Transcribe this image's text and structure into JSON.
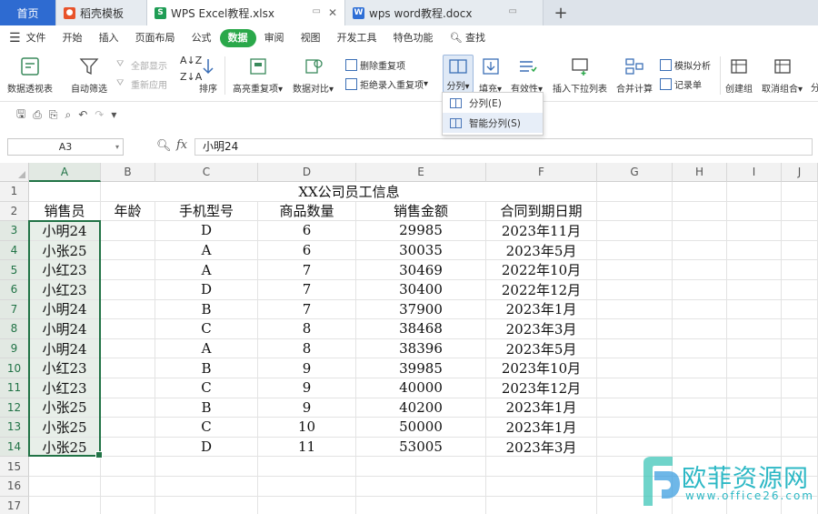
{
  "tabs": {
    "home": "首页",
    "items": [
      {
        "label": "稻壳模板"
      },
      {
        "label": "WPS Excel教程.xlsx"
      },
      {
        "label": "wps word教程.docx"
      }
    ],
    "new_tab": "+"
  },
  "menu": {
    "file": "文件",
    "items": [
      "开始",
      "插入",
      "页面布局",
      "公式",
      "数据",
      "审阅",
      "视图",
      "开发工具",
      "特色功能"
    ],
    "active": "数据",
    "search": "查找"
  },
  "ribbon": {
    "pivot": "数据透视表",
    "autofilter": "自动筛选",
    "show_all": "全部显示",
    "reapply": "重新应用",
    "sort": "排序",
    "highlight_dup": "高亮重复项",
    "compare": "数据对比",
    "remove_dup": "删除重复项",
    "reject_dup": "拒绝录入重复项",
    "split": "分列",
    "fill": "填充",
    "validity": "有效性",
    "insert_dropdown": "插入下拉列表",
    "consolidate": "合并计算",
    "simulate": "模拟分析",
    "record": "记录单",
    "create_group": "创建组",
    "ungroup": "取消组合",
    "more": "分"
  },
  "dropdown": {
    "items": [
      "分列(E)",
      "智能分列(S)"
    ]
  },
  "formula_bar": {
    "cell_ref": "A3",
    "fx": "fx",
    "content": "小明24"
  },
  "sheet": {
    "columns": [
      "A",
      "B",
      "C",
      "D",
      "E",
      "F",
      "G",
      "H",
      "I",
      "J"
    ],
    "rows": [
      "1",
      "2",
      "3",
      "4",
      "5",
      "6",
      "7",
      "8",
      "9",
      "10",
      "11",
      "12",
      "13",
      "14",
      "15",
      "16",
      "17"
    ],
    "title": "XX公司员工信息",
    "headers": [
      "销售员",
      "年龄",
      "手机型号",
      "商品数量",
      "销售金额",
      "合同到期日期"
    ],
    "data": [
      [
        "小明24",
        "",
        "D",
        "6",
        "29985",
        "2023年11月"
      ],
      [
        "小张25",
        "",
        "A",
        "6",
        "30035",
        "2023年5月"
      ],
      [
        "小红23",
        "",
        "A",
        "7",
        "30469",
        "2022年10月"
      ],
      [
        "小红23",
        "",
        "D",
        "7",
        "30400",
        "2022年12月"
      ],
      [
        "小明24",
        "",
        "B",
        "7",
        "37900",
        "2023年1月"
      ],
      [
        "小明24",
        "",
        "C",
        "8",
        "38468",
        "2023年3月"
      ],
      [
        "小明24",
        "",
        "A",
        "8",
        "38396",
        "2023年5月"
      ],
      [
        "小红23",
        "",
        "B",
        "9",
        "39985",
        "2023年10月"
      ],
      [
        "小红23",
        "",
        "C",
        "9",
        "40000",
        "2023年12月"
      ],
      [
        "小张25",
        "",
        "B",
        "9",
        "40200",
        "2023年1月"
      ],
      [
        "小张25",
        "",
        "C",
        "10",
        "50000",
        "2023年1月"
      ],
      [
        "小张25",
        "",
        "D",
        "11",
        "53005",
        "2023年3月"
      ]
    ]
  },
  "watermark": {
    "text": "欧菲资源网",
    "url": "www.office26.com"
  },
  "colors": {
    "accent_green": "#217346",
    "menu_active": "#2aa84a",
    "home_tab": "#2e6bd1",
    "watermark": "#2db8c5"
  }
}
